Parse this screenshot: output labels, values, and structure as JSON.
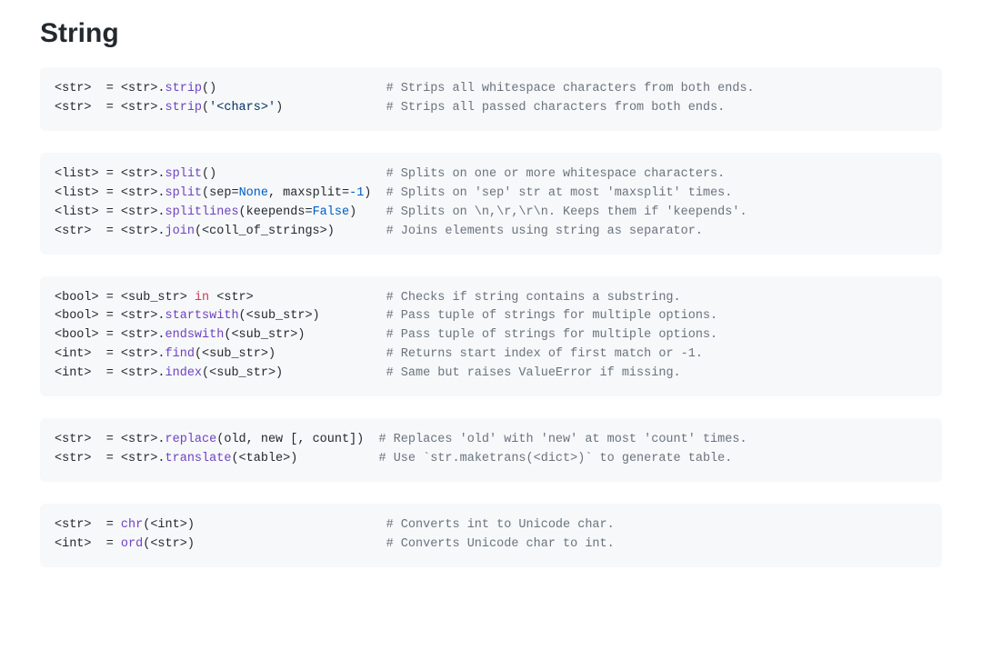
{
  "heading": "String",
  "blocks": [
    {
      "lines": [
        [
          {
            "t": "txt",
            "s": "<str>  = <str>."
          },
          {
            "t": "call",
            "s": "strip"
          },
          {
            "t": "txt",
            "s": "()"
          },
          {
            "t": "pad",
            "s": "                       "
          },
          {
            "t": "cmt",
            "s": "# Strips all whitespace characters from both ends."
          }
        ],
        [
          {
            "t": "txt",
            "s": "<str>  = <str>."
          },
          {
            "t": "call",
            "s": "strip"
          },
          {
            "t": "txt",
            "s": "("
          },
          {
            "t": "str",
            "s": "'<chars>'"
          },
          {
            "t": "txt",
            "s": ")"
          },
          {
            "t": "pad",
            "s": "              "
          },
          {
            "t": "cmt",
            "s": "# Strips all passed characters from both ends."
          }
        ]
      ]
    },
    {
      "lines": [
        [
          {
            "t": "txt",
            "s": "<list> = <str>."
          },
          {
            "t": "call",
            "s": "split"
          },
          {
            "t": "txt",
            "s": "()"
          },
          {
            "t": "pad",
            "s": "                       "
          },
          {
            "t": "cmt",
            "s": "# Splits on one or more whitespace characters."
          }
        ],
        [
          {
            "t": "txt",
            "s": "<list> = <str>."
          },
          {
            "t": "call",
            "s": "split"
          },
          {
            "t": "txt",
            "s": "(sep="
          },
          {
            "t": "kw",
            "s": "None"
          },
          {
            "t": "txt",
            "s": ", maxsplit="
          },
          {
            "t": "num",
            "s": "-1"
          },
          {
            "t": "txt",
            "s": ")"
          },
          {
            "t": "pad",
            "s": "  "
          },
          {
            "t": "cmt",
            "s": "# Splits on 'sep' str at most 'maxsplit' times."
          }
        ],
        [
          {
            "t": "txt",
            "s": "<list> = <str>."
          },
          {
            "t": "call",
            "s": "splitlines"
          },
          {
            "t": "txt",
            "s": "(keepends="
          },
          {
            "t": "kw",
            "s": "False"
          },
          {
            "t": "txt",
            "s": ")"
          },
          {
            "t": "pad",
            "s": "    "
          },
          {
            "t": "cmt",
            "s": "# Splits on \\n,\\r,\\r\\n. Keeps them if 'keepends'."
          }
        ],
        [
          {
            "t": "txt",
            "s": "<str>  = <str>."
          },
          {
            "t": "call",
            "s": "join"
          },
          {
            "t": "txt",
            "s": "(<coll_of_strings>)"
          },
          {
            "t": "pad",
            "s": "       "
          },
          {
            "t": "cmt",
            "s": "# Joins elements using string as separator."
          }
        ]
      ]
    },
    {
      "lines": [
        [
          {
            "t": "txt",
            "s": "<bool> = <sub_str> "
          },
          {
            "t": "op",
            "s": "in"
          },
          {
            "t": "txt",
            "s": " <str>"
          },
          {
            "t": "pad",
            "s": "                  "
          },
          {
            "t": "cmt",
            "s": "# Checks if string contains a substring."
          }
        ],
        [
          {
            "t": "txt",
            "s": "<bool> = <str>."
          },
          {
            "t": "call",
            "s": "startswith"
          },
          {
            "t": "txt",
            "s": "(<sub_str>)"
          },
          {
            "t": "pad",
            "s": "         "
          },
          {
            "t": "cmt",
            "s": "# Pass tuple of strings for multiple options."
          }
        ],
        [
          {
            "t": "txt",
            "s": "<bool> = <str>."
          },
          {
            "t": "call",
            "s": "endswith"
          },
          {
            "t": "txt",
            "s": "(<sub_str>)"
          },
          {
            "t": "pad",
            "s": "           "
          },
          {
            "t": "cmt",
            "s": "# Pass tuple of strings for multiple options."
          }
        ],
        [
          {
            "t": "txt",
            "s": "<int>  = <str>."
          },
          {
            "t": "call",
            "s": "find"
          },
          {
            "t": "txt",
            "s": "(<sub_str>)"
          },
          {
            "t": "pad",
            "s": "               "
          },
          {
            "t": "cmt",
            "s": "# Returns start index of first match or -1."
          }
        ],
        [
          {
            "t": "txt",
            "s": "<int>  = <str>."
          },
          {
            "t": "call",
            "s": "index"
          },
          {
            "t": "txt",
            "s": "(<sub_str>)"
          },
          {
            "t": "pad",
            "s": "              "
          },
          {
            "t": "cmt",
            "s": "# Same but raises ValueError if missing."
          }
        ]
      ]
    },
    {
      "lines": [
        [
          {
            "t": "txt",
            "s": "<str>  = <str>."
          },
          {
            "t": "call",
            "s": "replace"
          },
          {
            "t": "txt",
            "s": "(old, new [, count])"
          },
          {
            "t": "pad",
            "s": "  "
          },
          {
            "t": "cmt",
            "s": "# Replaces 'old' with 'new' at most 'count' times."
          }
        ],
        [
          {
            "t": "txt",
            "s": "<str>  = <str>."
          },
          {
            "t": "call",
            "s": "translate"
          },
          {
            "t": "txt",
            "s": "(<table>)"
          },
          {
            "t": "pad",
            "s": "           "
          },
          {
            "t": "cmt",
            "s": "# Use `str.maketrans(<dict>)` to generate table."
          }
        ]
      ]
    },
    {
      "lines": [
        [
          {
            "t": "txt",
            "s": "<str>  = "
          },
          {
            "t": "call",
            "s": "chr"
          },
          {
            "t": "txt",
            "s": "(<int>)"
          },
          {
            "t": "pad",
            "s": "                          "
          },
          {
            "t": "cmt",
            "s": "# Converts int to Unicode char."
          }
        ],
        [
          {
            "t": "txt",
            "s": "<int>  = "
          },
          {
            "t": "call",
            "s": "ord"
          },
          {
            "t": "txt",
            "s": "(<str>)"
          },
          {
            "t": "pad",
            "s": "                          "
          },
          {
            "t": "cmt",
            "s": "# Converts Unicode char to int."
          }
        ]
      ]
    }
  ]
}
